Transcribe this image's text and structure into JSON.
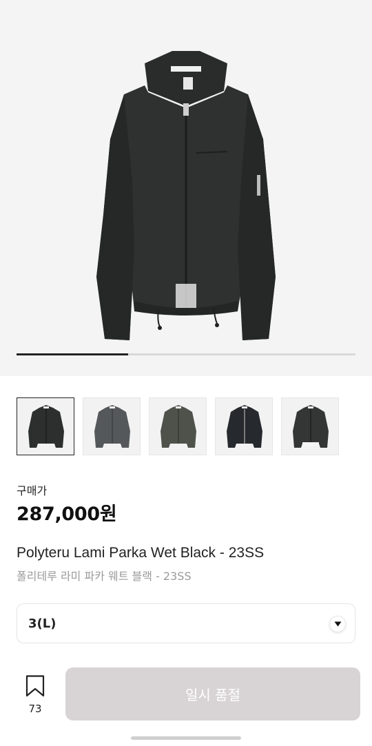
{
  "gallery": {
    "progress_fraction": 0.33,
    "thumbnails": [
      {
        "icon": "jacket-black-thumbnail",
        "color": "#2d2f2f",
        "active": true
      },
      {
        "icon": "jacket-grey-thumbnail",
        "color": "#55585a",
        "active": false
      },
      {
        "icon": "jacket-olive-thumbnail",
        "color": "#4e524b",
        "active": false
      },
      {
        "icon": "jacket-navy-black-thumbnail",
        "color": "#26292d",
        "active": false
      },
      {
        "icon": "jacket-charcoal-thumbnail",
        "color": "#333634",
        "active": false
      }
    ]
  },
  "product": {
    "price_label": "구매가",
    "price": "287,000원",
    "name_en": "Polyteru Lami Parka Wet Black - 23SS",
    "name_ko": "폴리테루 라미 파카 웨트 블랙 - 23SS"
  },
  "size_select": {
    "value": "3(L)",
    "icon": "chevron-down-icon"
  },
  "actions": {
    "bookmark_icon": "bookmark-icon",
    "bookmark_count": "73",
    "soldout_label": "일시 품절",
    "soldout_color": "#d8d4d6"
  }
}
